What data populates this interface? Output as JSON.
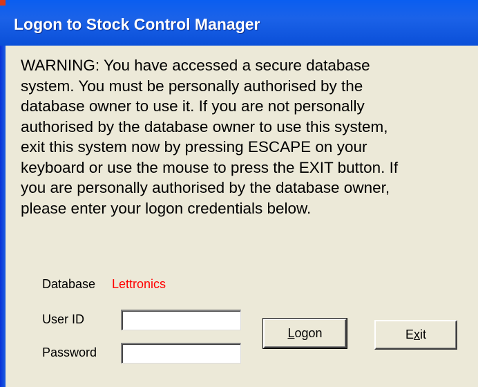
{
  "window": {
    "title": "Logon to Stock Control Manager"
  },
  "warning": {
    "lines": [
      "WARNING:  You have accessed a secure database",
      "system.  You must be personally authorised by the",
      "database owner to use it.  If you are not personally",
      "authorised by the database owner to use this system,",
      "exit this system now by pressing ESCAPE on your",
      "keyboard or use the mouse to press the EXIT button.  If",
      "you are personally authorised by the database owner,",
      "please enter your logon credentials below."
    ]
  },
  "form": {
    "database_label": "Database",
    "database_value": "Lettronics",
    "user_id_label": "User ID",
    "user_id_value": "",
    "password_label": "Password",
    "password_value": ""
  },
  "buttons": {
    "logon_accel": "L",
    "logon_rest": "ogon",
    "exit_pre": "E",
    "exit_accel": "x",
    "exit_post": "it"
  },
  "colors": {
    "titlebar": "#0a5ef0",
    "window_bg": "#ece9d8",
    "database_value": "#ff0000"
  }
}
